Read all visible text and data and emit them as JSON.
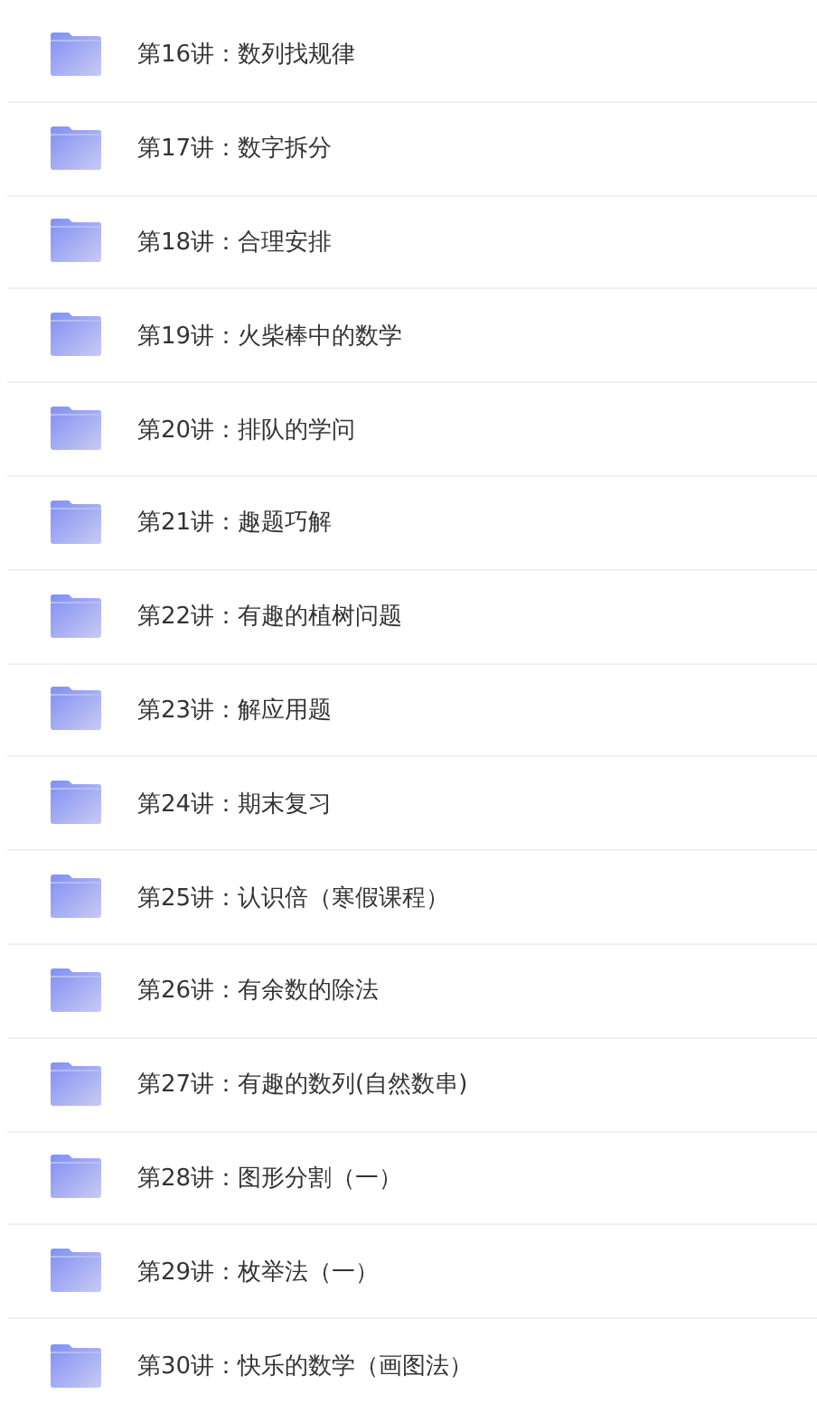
{
  "folders": [
    {
      "name": "第16讲：数列找规律"
    },
    {
      "name": "第17讲：数字拆分"
    },
    {
      "name": "第18讲：合理安排"
    },
    {
      "name": "第19讲：火柴棒中的数学"
    },
    {
      "name": "第20讲：排队的学问"
    },
    {
      "name": "第21讲：趣题巧解"
    },
    {
      "name": "第22讲：有趣的植树问题"
    },
    {
      "name": "第23讲：解应用题"
    },
    {
      "name": "第24讲：期末复习"
    },
    {
      "name": "第25讲：认识倍（寒假课程）"
    },
    {
      "name": "第26讲：有余数的除法"
    },
    {
      "name": "第27讲：有趣的数列(自然数串)"
    },
    {
      "name": "第28讲：图形分割（一）"
    },
    {
      "name": "第29讲：枚举法（一）"
    },
    {
      "name": "第30讲：快乐的数学（画图法）"
    }
  ]
}
